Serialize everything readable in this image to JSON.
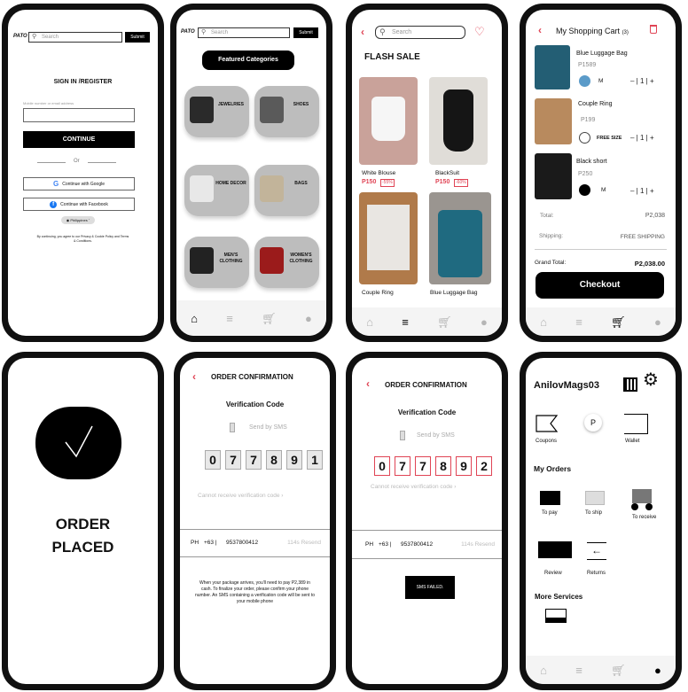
{
  "login": {
    "logo": "PATO",
    "search_placeholder": "Search",
    "submit_label": "Submit",
    "heading": "SIGN IN /REGISTER",
    "input_label": "Mobile number or email address",
    "continue_label": "CONTINUE",
    "or_label": "Or",
    "google_label": "Continue with Google",
    "facebook_label": "Continue with Facebook",
    "region_label": "Philippines",
    "terms_text": "By continuing, you agree to our Privacy & Cookie Policy and Terms & Conditions."
  },
  "categories": {
    "logo": "PATO",
    "search_placeholder": "Search",
    "submit_label": "Submit",
    "heading": "Featured Categories",
    "items": [
      {
        "label": "JEWELRIES"
      },
      {
        "label": "SHOES"
      },
      {
        "label": "HOME DECOR"
      },
      {
        "label": "BAGS"
      },
      {
        "label": "MEN'S CLOTHING"
      },
      {
        "label": "WOMEN'S CLOTHING"
      }
    ]
  },
  "flash": {
    "search_placeholder": "Search",
    "heading": "FLASH SALE",
    "products": [
      {
        "name": "White Blouse",
        "price": "P150",
        "discount": "-55%"
      },
      {
        "name": "BlackSuit",
        "price": "P150",
        "discount": "-60%"
      },
      {
        "name": "Couple Ring",
        "price": "",
        "discount": ""
      },
      {
        "name": "Blue Luggage Bag",
        "price": "",
        "discount": ""
      }
    ]
  },
  "cart": {
    "title": "My Shopping Cart",
    "count": "(3)",
    "items": [
      {
        "name": "Blue Luggage Bag",
        "price": "P1589",
        "size": "M",
        "qty": "1"
      },
      {
        "name": "Couple Ring",
        "price": "P199",
        "size": "FREE SIZE",
        "qty": "1"
      },
      {
        "name": "Black short",
        "price": "P250",
        "size": "M",
        "qty": "1"
      }
    ],
    "total_label": "Total:",
    "total_value": "P2,038",
    "shipping_label": "Shipping:",
    "shipping_value": "FREE SHIPPING",
    "grand_label": "Grand Total:",
    "grand_value": "P2,038.00",
    "checkout_label": "Checkout"
  },
  "placed": {
    "line1": "ORDER",
    "line2": "PLACED"
  },
  "confirm1": {
    "title": "ORDER CONFIRMATION",
    "subtitle": "Verification Code",
    "sms_label": "Send by SMS",
    "digits": [
      "0",
      "7",
      "7",
      "8",
      "9",
      "1"
    ],
    "cannot_label": "Cannot receive verification code",
    "country": "PH",
    "code": "+63 |",
    "phone": "9537800412",
    "resend": "114s Resend",
    "info": "When your package arrives, you'll need to pay P2,389 in cash. To finalize your order, please confirm your phone number. An SMS containing a verification code will be sent to your mobile phone"
  },
  "confirm2": {
    "title": "ORDER CONFIRMATION",
    "subtitle": "Verification Code",
    "sms_label": "Send by SMS",
    "digits": [
      "0",
      "7",
      "7",
      "8",
      "9",
      "2"
    ],
    "cannot_label": "Cannot receive verification code",
    "country": "PH",
    "code": "+63 |",
    "phone": "9537800412",
    "resend": "114s Resend",
    "failed": "SMS FAILED."
  },
  "profile": {
    "username": "AnilovMags03",
    "coupons": "Coupons",
    "p_badge": "P",
    "wallet": "Wallet",
    "orders_heading": "My Orders",
    "to_pay": "To pay",
    "to_ship": "To ship",
    "to_receive": "To receive",
    "review": "Review",
    "returns": "Returns",
    "more_heading": "More Services"
  },
  "colors": {
    "accent": "#e04455",
    "black": "#000000",
    "grey_card": "#bdbdbd"
  }
}
